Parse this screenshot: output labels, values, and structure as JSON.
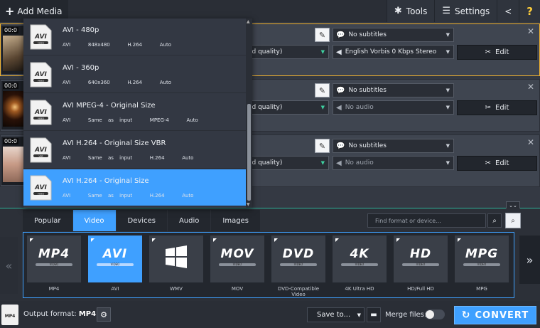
{
  "topbar": {
    "add_media": "Add Media",
    "tools": "Tools",
    "settings": "Settings",
    "help": "?"
  },
  "files": [
    {
      "time": "00:0",
      "quality": "od quality)",
      "subtitles": "No subtitles",
      "audio": "English Vorbis 0 Kbps Stereo",
      "edit": "Edit"
    },
    {
      "time": "00:0",
      "quality": "od quality)",
      "subtitles": "No subtitles",
      "audio": "No audio",
      "edit": "Edit"
    },
    {
      "time": "00:0",
      "quality": "od quality)",
      "subtitles": "No subtitles",
      "audio": "No audio",
      "edit": "Edit"
    }
  ],
  "preset_dropdown": {
    "items": [
      {
        "icon_text": "AVI",
        "badge": "VIDEO",
        "title": "AVI - 480p",
        "meta": "AVI   848x480   H.264   Auto"
      },
      {
        "icon_text": "AVI",
        "badge": "VIDEO",
        "title": "AVI - 360p",
        "meta": "AVI   640x360   H.264   Auto"
      },
      {
        "icon_text": "AVI",
        "badge": "VIDEO",
        "title": "AVI MPEG-4 - Original Size",
        "meta": "AVI   Same as input   MPEG-4   Auto"
      },
      {
        "icon_text": "AVI",
        "badge": "VBR",
        "title": "AVI H.264 - Original Size VBR",
        "meta": "AVI   Same as input   H.264   Auto"
      },
      {
        "icon_text": "AVI",
        "badge": "VIDEO",
        "title": "AVI H.264 - Original Size",
        "meta": "AVI   Same as input   H.264   Auto"
      }
    ],
    "selected_index": 4
  },
  "format_panel": {
    "tabs": [
      "Popular",
      "Video",
      "Devices",
      "Audio",
      "Images"
    ],
    "active_tab": "Video",
    "search_placeholder": "Find format or device...",
    "formats": [
      {
        "logo": "MP4",
        "label": "MP4"
      },
      {
        "logo": "AVI",
        "label": "AVI"
      },
      {
        "logo": "",
        "label": "WMV"
      },
      {
        "logo": "MOV",
        "label": "MOV"
      },
      {
        "logo": "DVD",
        "label": "DVD-Compatible Video"
      },
      {
        "logo": "4K",
        "label": "4K Ultra HD"
      },
      {
        "logo": "HD",
        "label": "HD/Full HD"
      },
      {
        "logo": "MPG",
        "label": "MPG"
      }
    ],
    "selected_format": "AVI",
    "band_text": "VIDEO"
  },
  "bottombar": {
    "output_prefix": "Output format:",
    "output_format": "MP4",
    "save_to": "Save to...",
    "merge_files": "Merge files:",
    "convert": "CONVERT"
  },
  "colors": {
    "accent": "#3fa0ff",
    "active_border": "#f0b230",
    "help": "#ffcf3a"
  }
}
